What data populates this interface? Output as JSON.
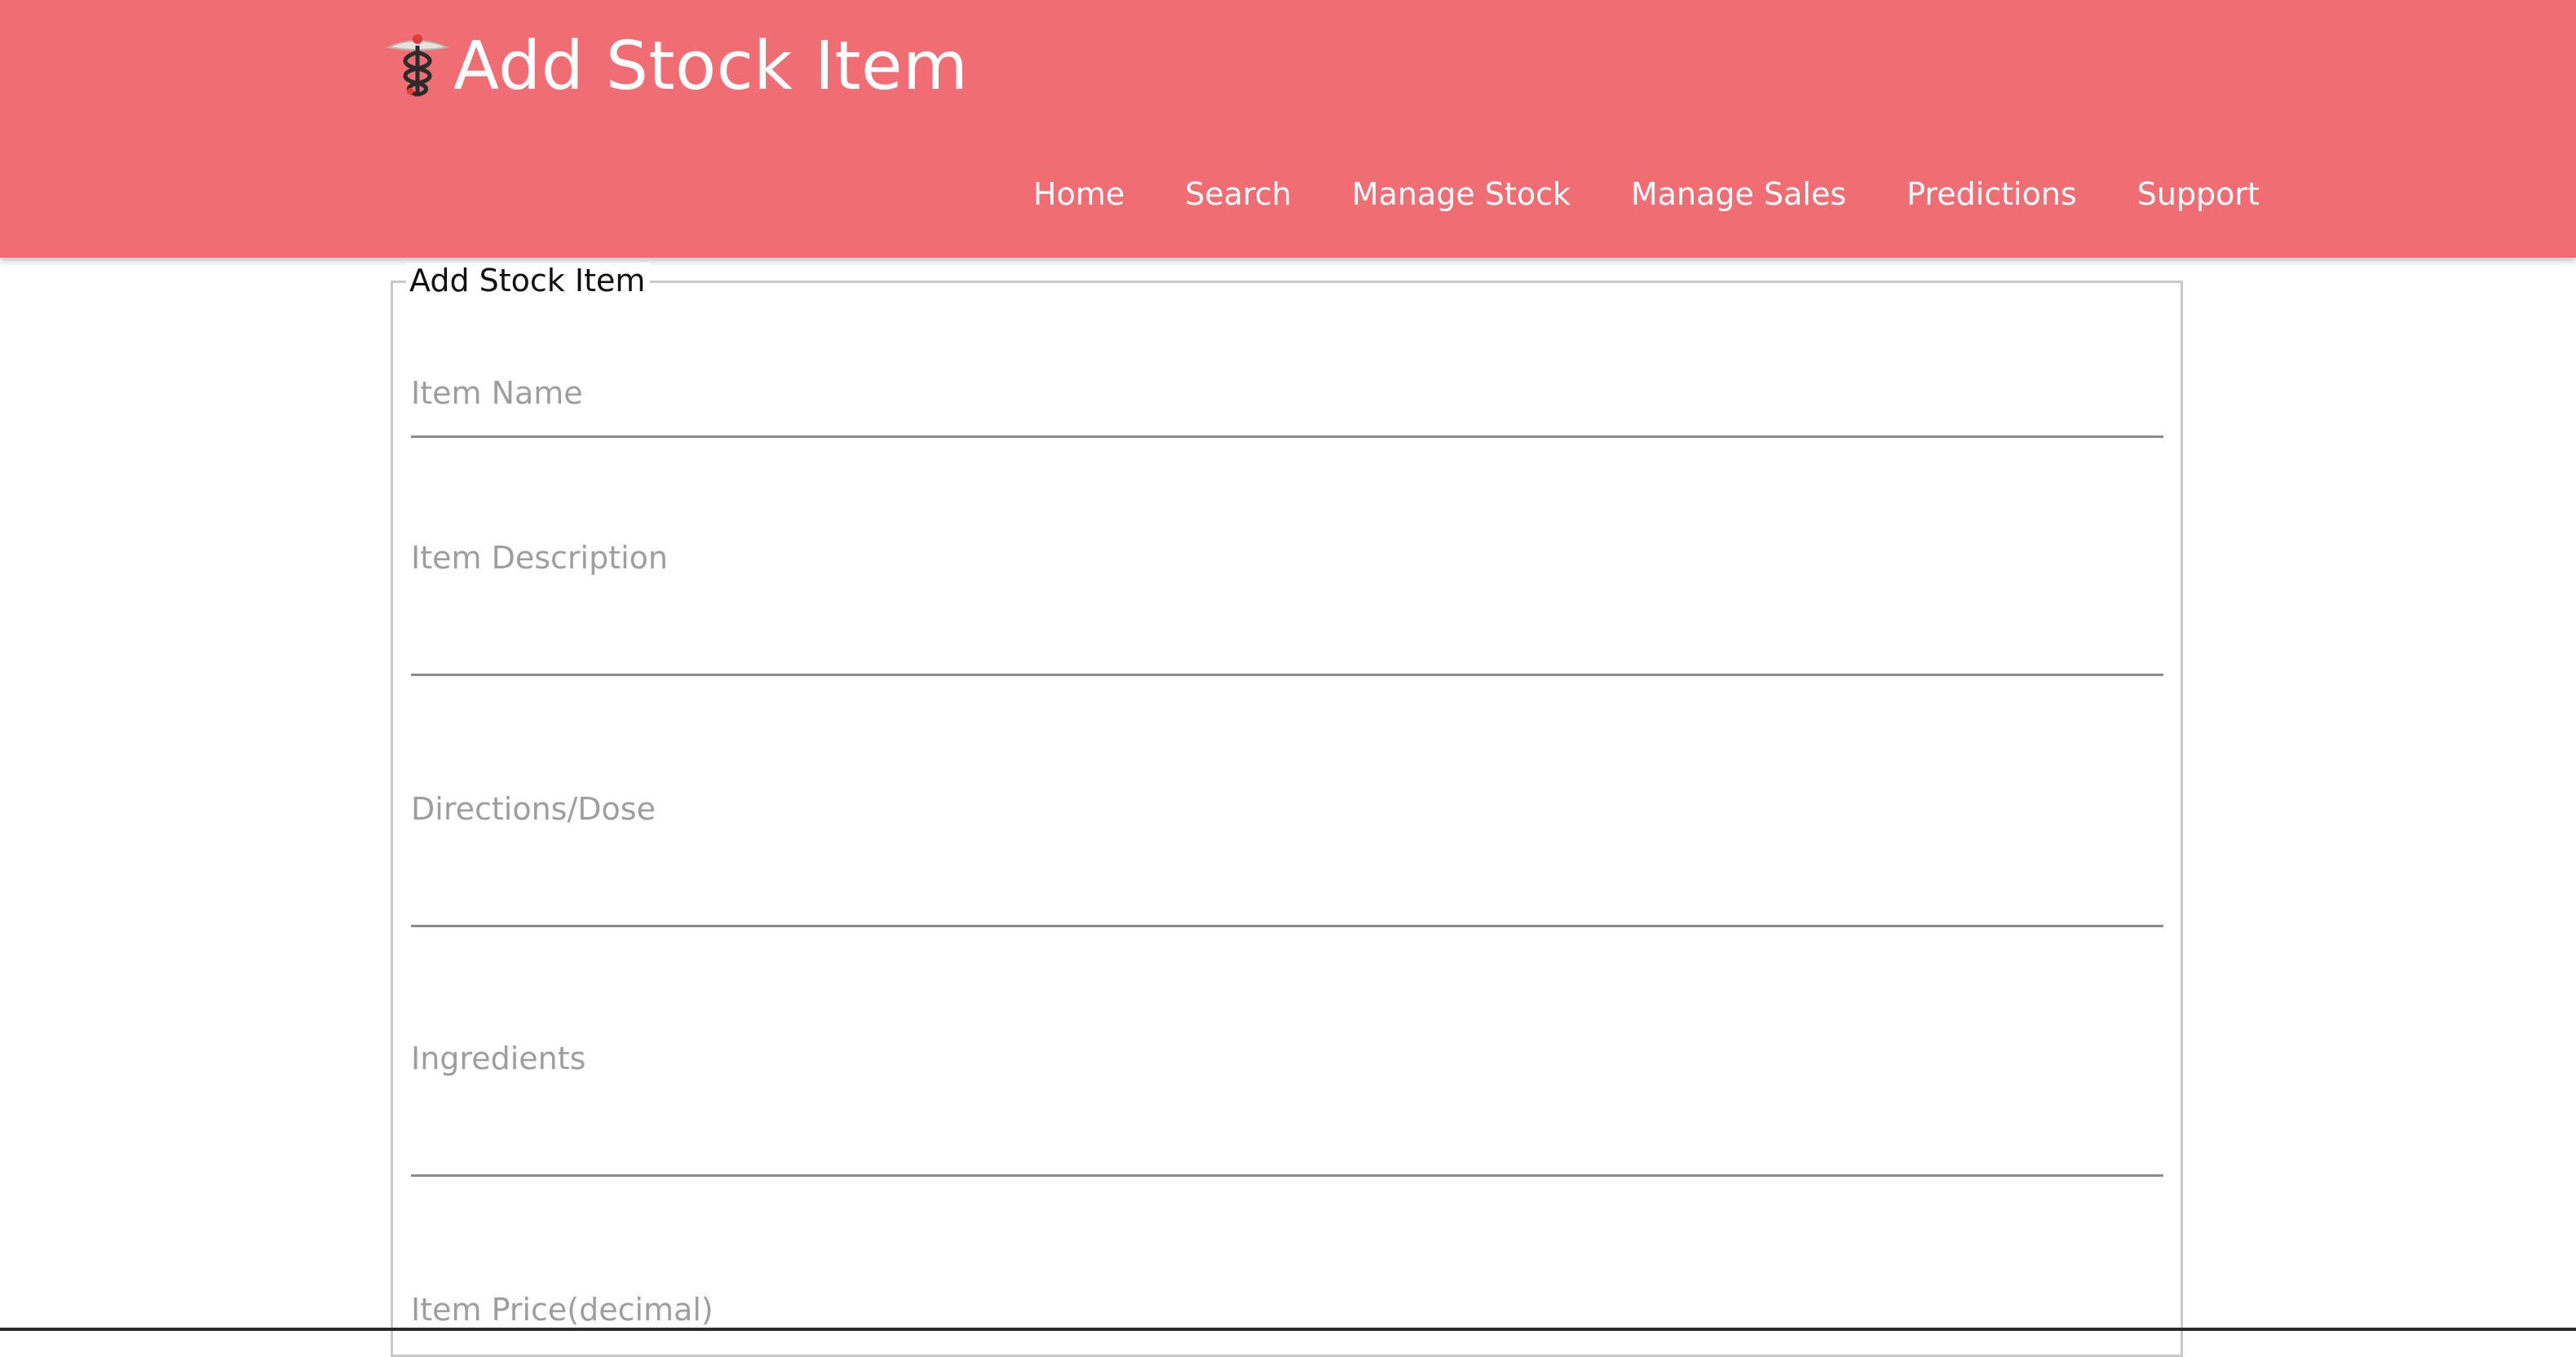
{
  "header": {
    "title": "Add Stock Item",
    "logo_icon": "caduceus-icon",
    "background_color": "#ef6d73"
  },
  "nav": {
    "items": [
      {
        "label": "Home"
      },
      {
        "label": "Search"
      },
      {
        "label": "Manage Stock"
      },
      {
        "label": "Manage Sales"
      },
      {
        "label": "Predictions"
      },
      {
        "label": "Support"
      }
    ]
  },
  "form": {
    "legend": "Add Stock Item",
    "fields": [
      {
        "label": "Item Name",
        "value": ""
      },
      {
        "label": "Item Description",
        "value": ""
      },
      {
        "label": "Directions/Dose",
        "value": ""
      },
      {
        "label": "Ingredients",
        "value": ""
      },
      {
        "label": "Item Price(decimal)",
        "value": ""
      }
    ]
  }
}
